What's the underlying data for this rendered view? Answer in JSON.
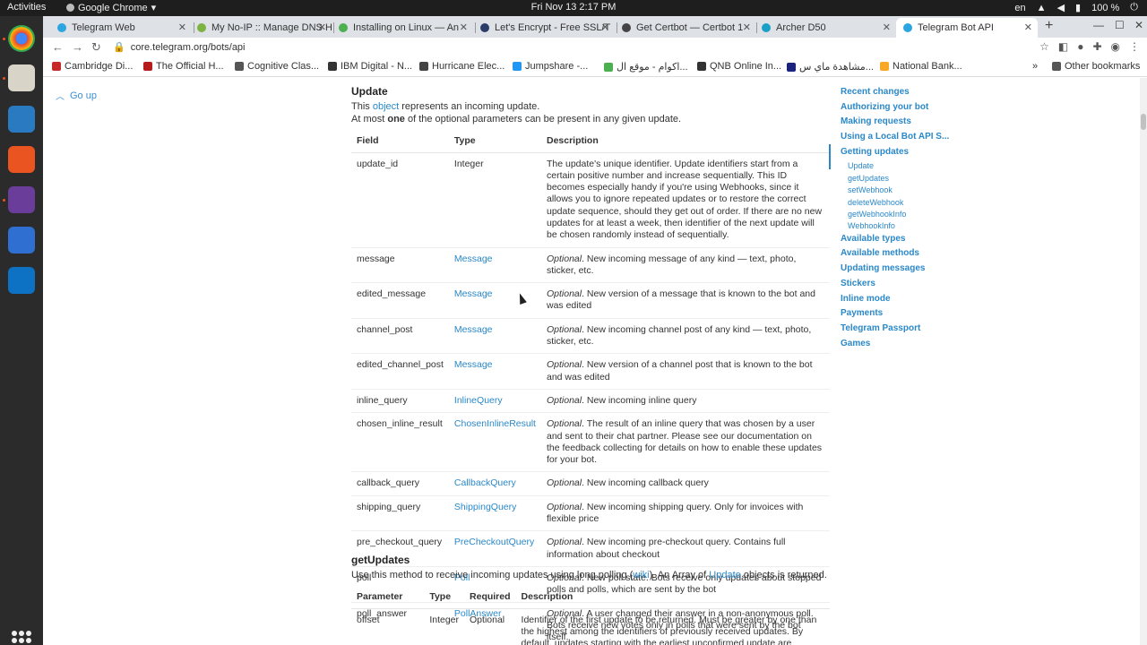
{
  "system": {
    "activities": "Activities",
    "app_name": "Google Chrome",
    "clock": "Fri Nov 13  2:17 PM",
    "lang": "en",
    "battery": "100 %"
  },
  "tabs": [
    {
      "label": "Telegram Web",
      "color": "#2ca5e0"
    },
    {
      "label": "My No-IP :: Manage DNS H",
      "color": "#7cb342"
    },
    {
      "label": "Installing on Linux — An",
      "color": "#4caf50"
    },
    {
      "label": "Let's Encrypt - Free SSL/T",
      "color": "#2c3c69"
    },
    {
      "label": "Get Certbot — Certbot 1",
      "color": "#444444"
    },
    {
      "label": "Archer D50",
      "color": "#1a9fc7"
    },
    {
      "label": "Telegram Bot API",
      "color": "#2ca5e0"
    }
  ],
  "address": {
    "url": "core.telegram.org/bots/api"
  },
  "bookmarks": [
    {
      "label": "Cambridge Di...",
      "color": "#c62828"
    },
    {
      "label": "The Official H...",
      "color": "#b71c1c"
    },
    {
      "label": "Cognitive Clas...",
      "color": "#555555"
    },
    {
      "label": "IBM Digital - N...",
      "color": "#333333"
    },
    {
      "label": "Hurricane Elec...",
      "color": "#444444"
    },
    {
      "label": "Jumpshare -...",
      "color": "#2196f3"
    },
    {
      "label": "اكوام - موقع ال...",
      "color": "#4caf50"
    },
    {
      "label": "QNB Online In...",
      "color": "#333333"
    },
    {
      "label": "مشاهدة ماي س...",
      "color": "#1a237e"
    },
    {
      "label": "National Bank...",
      "color": "#f9a825"
    },
    {
      "label": "Other bookmarks",
      "color": "#555555"
    }
  ],
  "page": {
    "go_up": "Go up",
    "update": {
      "title": "Update",
      "line1_pre": "This ",
      "line1_link": "object",
      "line1_post": " represents an incoming update.",
      "line2_pre": "At most ",
      "line2_bold": "one",
      "line2_post": " of the optional parameters can be present in any given update.",
      "headers": [
        "Field",
        "Type",
        "Description"
      ],
      "rows": [
        {
          "field": "update_id",
          "type": "Integer",
          "type_link": false,
          "desc": "The update's unique identifier. Update identifiers start from a certain positive number and increase sequentially. This ID becomes especially handy if you're using Webhooks, since it allows you to ignore repeated updates or to restore the correct update sequence, should they get out of order. If there are no new updates for at least a week, then identifier of the next update will be chosen randomly instead of sequentially."
        },
        {
          "field": "message",
          "type": "Message",
          "type_link": true,
          "desc": "Optional. New incoming message of any kind — text, photo, sticker, etc."
        },
        {
          "field": "edited_message",
          "type": "Message",
          "type_link": true,
          "desc": "Optional. New version of a message that is known to the bot and was edited"
        },
        {
          "field": "channel_post",
          "type": "Message",
          "type_link": true,
          "desc": "Optional. New incoming channel post of any kind — text, photo, sticker, etc."
        },
        {
          "field": "edited_channel_post",
          "type": "Message",
          "type_link": true,
          "desc": "Optional. New version of a channel post that is known to the bot and was edited"
        },
        {
          "field": "inline_query",
          "type": "InlineQuery",
          "type_link": true,
          "desc": "Optional. New incoming inline query"
        },
        {
          "field": "chosen_inline_result",
          "type": "ChosenInlineResult",
          "type_link": true,
          "desc": "Optional. The result of an inline query that was chosen by a user and sent to their chat partner. Please see our documentation on the feedback collecting for details on how to enable these updates for your bot."
        },
        {
          "field": "callback_query",
          "type": "CallbackQuery",
          "type_link": true,
          "desc": "Optional. New incoming callback query"
        },
        {
          "field": "shipping_query",
          "type": "ShippingQuery",
          "type_link": true,
          "desc": "Optional. New incoming shipping query. Only for invoices with flexible price"
        },
        {
          "field": "pre_checkout_query",
          "type": "PreCheckoutQuery",
          "type_link": true,
          "desc": "Optional. New incoming pre-checkout query. Contains full information about checkout"
        },
        {
          "field": "poll",
          "type": "Poll",
          "type_link": true,
          "desc": "Optional. New poll state. Bots receive only updates about stopped polls and polls, which are sent by the bot"
        },
        {
          "field": "poll_answer",
          "type": "PollAnswer",
          "type_link": true,
          "desc": "Optional. A user changed their answer in a non-anonymous poll. Bots receive new votes only in polls that were sent by the bot itself."
        }
      ]
    },
    "getupdates": {
      "title": "getUpdates",
      "line_pre": "Use this method to receive incoming updates using long polling (",
      "line_link1": "wiki",
      "line_mid": "). An Array of ",
      "line_link2": "Update",
      "line_post": " objects is returned.",
      "headers": [
        "Parameter",
        "Type",
        "Required",
        "Description"
      ],
      "rows": [
        {
          "param": "offset",
          "type": "Integer",
          "required": "Optional",
          "desc": "Identifier of the first update to be returned. Must be greater by one than the highest among the identifiers of previously received updates. By default, updates starting with the earliest unconfirmed update are returned. An update is considered"
        }
      ]
    }
  },
  "toc": {
    "items": [
      {
        "label": "Recent changes",
        "sub": false
      },
      {
        "label": "Authorizing your bot",
        "sub": false
      },
      {
        "label": "Making requests",
        "sub": false
      },
      {
        "label": "Using a Local Bot API S...",
        "sub": false
      },
      {
        "label": "Getting updates",
        "sub": false
      },
      {
        "label": "Update",
        "sub": true
      },
      {
        "label": "getUpdates",
        "sub": true
      },
      {
        "label": "setWebhook",
        "sub": true
      },
      {
        "label": "deleteWebhook",
        "sub": true
      },
      {
        "label": "getWebhookInfo",
        "sub": true
      },
      {
        "label": "WebhookInfo",
        "sub": true
      },
      {
        "label": "Available types",
        "sub": false
      },
      {
        "label": "Available methods",
        "sub": false
      },
      {
        "label": "Updating messages",
        "sub": false
      },
      {
        "label": "Stickers",
        "sub": false
      },
      {
        "label": "Inline mode",
        "sub": false
      },
      {
        "label": "Payments",
        "sub": false
      },
      {
        "label": "Telegram Passport",
        "sub": false
      },
      {
        "label": "Games",
        "sub": false
      }
    ]
  }
}
